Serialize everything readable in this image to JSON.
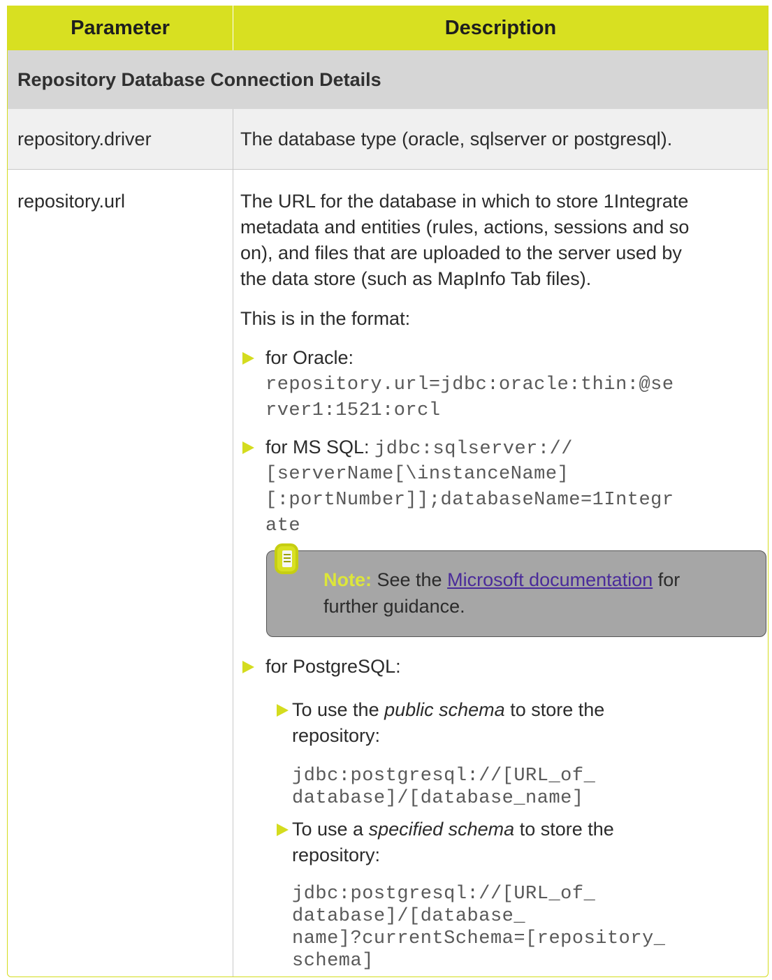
{
  "table": {
    "header": {
      "parameter": "Parameter",
      "description": "Description"
    },
    "section_title": "Repository Database Connection Details",
    "rows": [
      {
        "name": "repository.driver",
        "description": "The database type (oracle, sqlserver or postgresql)."
      },
      {
        "name": "repository.url",
        "description_lines": [
          "The URL for the database in which to store 1Integrate",
          "metadata and entities (rules, actions, sessions and so",
          "on), and files that are uploaded to the server used by",
          "the data store (such as MapInfo Tab files)."
        ],
        "format_intro": "This is in the format:",
        "oracle": {
          "label": "for Oracle:",
          "code_lines": [
            "repository.url=jdbc:oracle:thin:@se",
            "rver1:1521:orcl"
          ]
        },
        "mssql": {
          "label": "for MS SQL: ",
          "code_first": "jdbc:sqlserver://",
          "code_lines": [
            "[serverName[\\instanceName]",
            "[:portNumber]];databaseName=1Integr",
            "ate"
          ]
        },
        "note": {
          "label": "Note:",
          "text_before": " See the ",
          "link": "Microsoft documentation",
          "text_after": " for",
          "line2": "further guidance."
        },
        "postgres": {
          "label": "for PostgreSQL:",
          "public": {
            "prefix": "To use the ",
            "emphasis": "public schema",
            "suffix": " to store the",
            "line2": "repository:",
            "code_lines": [
              "jdbc:postgresql://[URL_of_",
              "database]/[database_name]"
            ]
          },
          "specified": {
            "prefix": "To use a ",
            "emphasis": "specified schema",
            "suffix": " to store the",
            "line2": "repository:",
            "code_lines": [
              "jdbc:postgresql://[URL_of_",
              "database]/[database_",
              "name]?currentSchema=[repository_",
              "schema]"
            ]
          }
        }
      }
    ]
  },
  "colors": {
    "accent": "#d8e021",
    "section_bg": "#d6d6d6",
    "note_bg": "#a6a6a6",
    "link": "#4a2b9a"
  }
}
